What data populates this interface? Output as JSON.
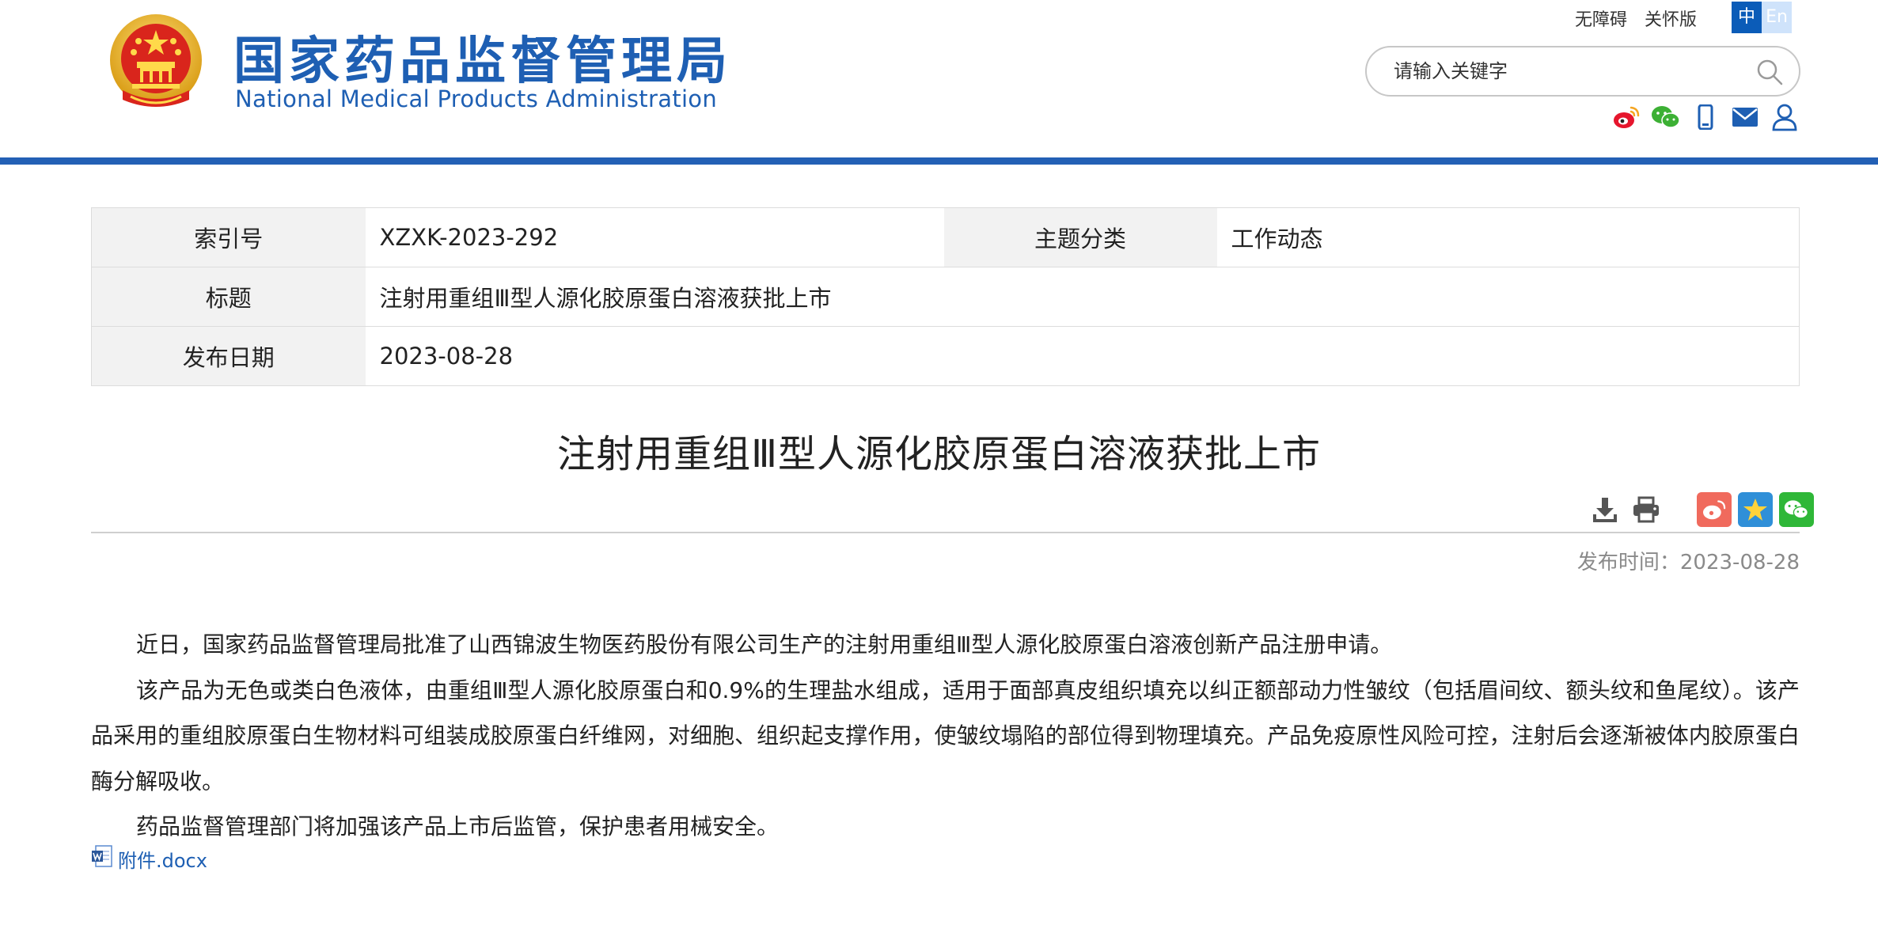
{
  "header": {
    "logo_cn": "国家药品监督管理局",
    "logo_en": "National Medical Products Administration",
    "links": {
      "accessibility": "无障碍",
      "care_mode": "关怀版"
    },
    "lang": {
      "zh": "中",
      "en": "En"
    },
    "search": {
      "placeholder": "请输入关键字"
    },
    "icons": [
      "weibo-icon",
      "wechat-icon",
      "mobile-icon",
      "mail-icon",
      "user-icon"
    ],
    "accent_color": "#2360b5"
  },
  "meta": {
    "index_label": "索引号",
    "index_value": "XZXK-2023-292",
    "topic_label": "主题分类",
    "topic_value": "工作动态",
    "title_label": "标题",
    "title_value": "注射用重组Ⅲ型人源化胶原蛋白溶液获批上市",
    "date_label": "发布日期",
    "date_value": "2023-08-28"
  },
  "article": {
    "title": "注射用重组Ⅲ型人源化胶原蛋白溶液获批上市",
    "pubtime_label": "发布时间：",
    "pubtime_value": "2023-08-28",
    "paragraphs": [
      "近日，国家药品监督管理局批准了山西锦波生物医药股份有限公司生产的注射用重组Ⅲ型人源化胶原蛋白溶液创新产品注册申请。",
      "该产品为无色或类白色液体，由重组Ⅲ型人源化胶原蛋白和0.9%的生理盐水组成，适用于面部真皮组织填充以纠正额部动力性皱纹（包括眉间纹、额头纹和鱼尾纹）。该产品采用的重组胶原蛋白生物材料可组装成胶原蛋白纤维网，对细胞、组织起支撑作用，使皱纹塌陷的部位得到物理填充。产品免疫原性风险可控，注射后会逐渐被体内胶原蛋白酶分解吸收。",
      "药品监督管理部门将加强该产品上市后监管，保护患者用械安全。"
    ],
    "attachment": "附件.docx"
  }
}
